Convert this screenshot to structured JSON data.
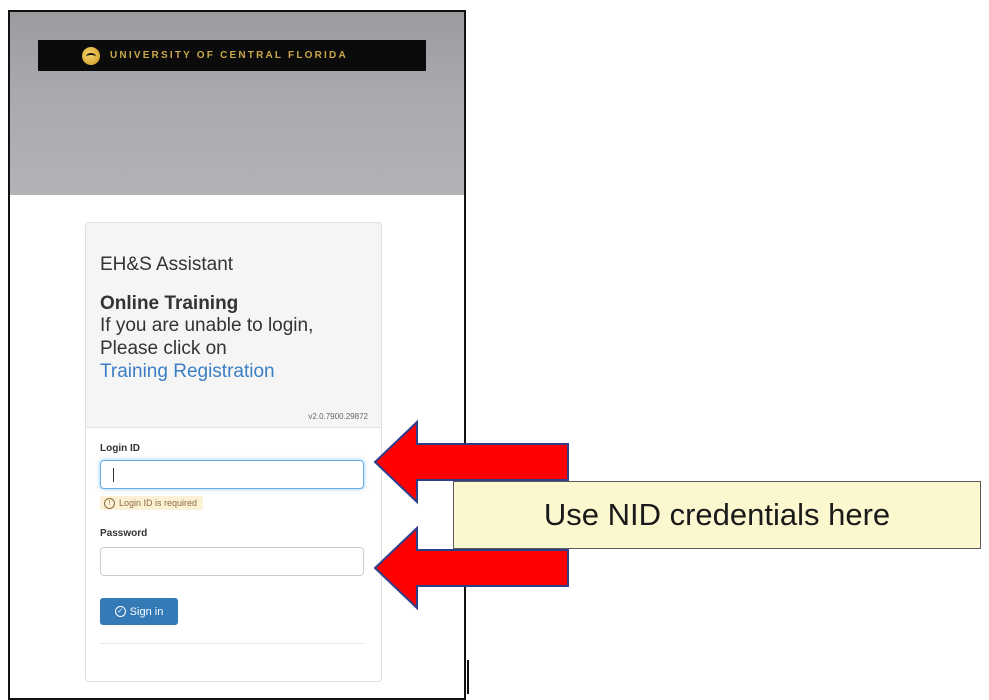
{
  "header": {
    "brand": "UNIVERSITY OF CENTRAL FLORIDA"
  },
  "card": {
    "app_name": "EH&S Assistant",
    "section_title": "Online Training",
    "message_line1": "If you are unable to login,",
    "message_line2": "Please click on",
    "registration_link": "Training Registration",
    "version": "v2.0.7900.29872"
  },
  "form": {
    "login_label": "Login ID",
    "login_value": "",
    "login_error": "Login ID is required",
    "password_label": "Password",
    "password_value": "",
    "signin_label": "Sign in"
  },
  "annotation": {
    "callout_text": "Use NID credentials here",
    "arrow_color": "#ff0000"
  }
}
